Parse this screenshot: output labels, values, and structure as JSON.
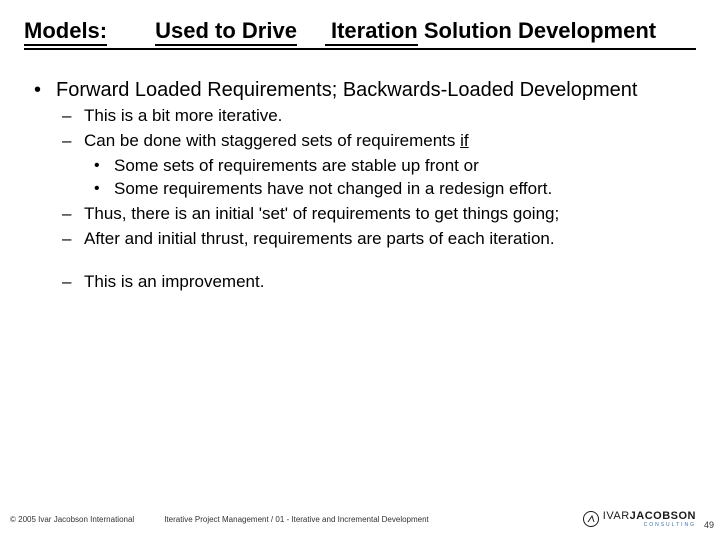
{
  "title": {
    "models": "Models:",
    "used_to_drive": "Used to Drive",
    "iteration_word": "Iteration",
    "rest": " Solution Development"
  },
  "main_bullet": "Forward Loaded Requirements;  Backwards-Loaded Development",
  "sub": {
    "a": "This is a bit more iterative.",
    "b_pre": "Can be done with staggered sets of requirements ",
    "b_if": "if",
    "c1": "Some sets of requirements are stable up front or",
    "c2": "Some requirements have not changed in a redesign effort.",
    "d": "Thus, there is an initial 'set' of requirements to get things going;",
    "e": "After and initial thrust, requirements are parts of each iteration.",
    "f": "This is an improvement."
  },
  "footer": {
    "copyright": "© 2005 Ivar Jacobson International",
    "breadcrumb": "Iterative Project Management / 01 - Iterative and Incremental Development",
    "logo_first": "IVAR",
    "logo_last": "JACOBSON",
    "logo_sub": "CONSULTING",
    "page": "49"
  }
}
